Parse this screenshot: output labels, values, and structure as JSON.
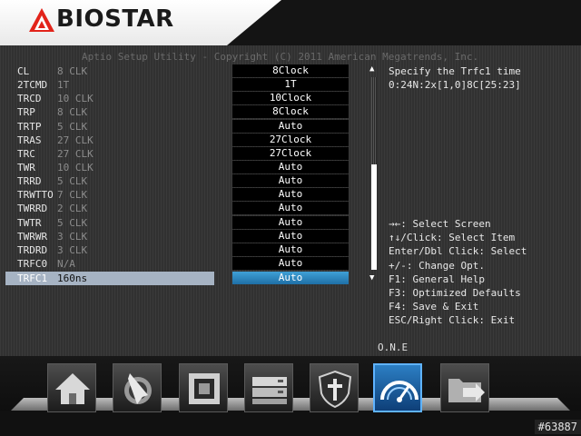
{
  "brand": {
    "name": "BIOSTAR"
  },
  "utility_title": "Aptio Setup Utility - Copyright (C) 2011 American Megatrends, Inc.",
  "settings": [
    {
      "name": "CL",
      "current": "8 CLK",
      "setting": "8Clock"
    },
    {
      "name": "2TCMD",
      "current": "1T",
      "setting": "1T"
    },
    {
      "name": "TRCD",
      "current": "10 CLK",
      "setting": "10Clock"
    },
    {
      "name": "TRP",
      "current": "8 CLK",
      "setting": "8Clock"
    },
    {
      "name": "TRTP",
      "current": "5 CLK",
      "setting": "Auto"
    },
    {
      "name": "TRAS",
      "current": "27 CLK",
      "setting": "27Clock"
    },
    {
      "name": "TRC",
      "current": "27 CLK",
      "setting": "27Clock"
    },
    {
      "name": "TWR",
      "current": "10 CLK",
      "setting": "Auto"
    },
    {
      "name": "TRRD",
      "current": "5 CLK",
      "setting": "Auto"
    },
    {
      "name": "TRWTTO",
      "current": "7 CLK",
      "setting": "Auto"
    },
    {
      "name": "TWRRD",
      "current": "2 CLK",
      "setting": "Auto"
    },
    {
      "name": "TWTR",
      "current": "5 CLK",
      "setting": "Auto"
    },
    {
      "name": "TWRWR",
      "current": "3 CLK",
      "setting": "Auto"
    },
    {
      "name": "TRDRD",
      "current": "3 CLK",
      "setting": "Auto"
    },
    {
      "name": "TRFC0",
      "current": "N/A",
      "setting": "Auto"
    },
    {
      "name": "TRFC1",
      "current": "160ns",
      "setting": "Auto",
      "selected": true
    }
  ],
  "help": {
    "line1": "Specify the Trfc1 time",
    "line2": "0:24N:2x[1,0]8C[25:23]"
  },
  "keys": [
    "→←: Select Screen",
    "↑↓/Click: Select Item",
    "Enter/Dbl Click: Select",
    "+/-: Change Opt.",
    "F1: General Help",
    "F3: Optimized Defaults",
    "F4: Save & Exit",
    "ESC/Right Click: Exit"
  ],
  "scroll": {
    "up": "▲",
    "down": "▼"
  },
  "dock": {
    "active_label": "O.N.E",
    "icons": [
      "home-icon",
      "pointer-icon",
      "chip-icon",
      "drives-icon",
      "security-shield-icon",
      "one-gauge-icon",
      "folder-exit-icon"
    ],
    "active_index": 5
  },
  "watermark": "#63887",
  "colors": {
    "accent": "#2a86cf",
    "selected_row": "#a6b3c3",
    "logo_red": "#e2231a"
  }
}
